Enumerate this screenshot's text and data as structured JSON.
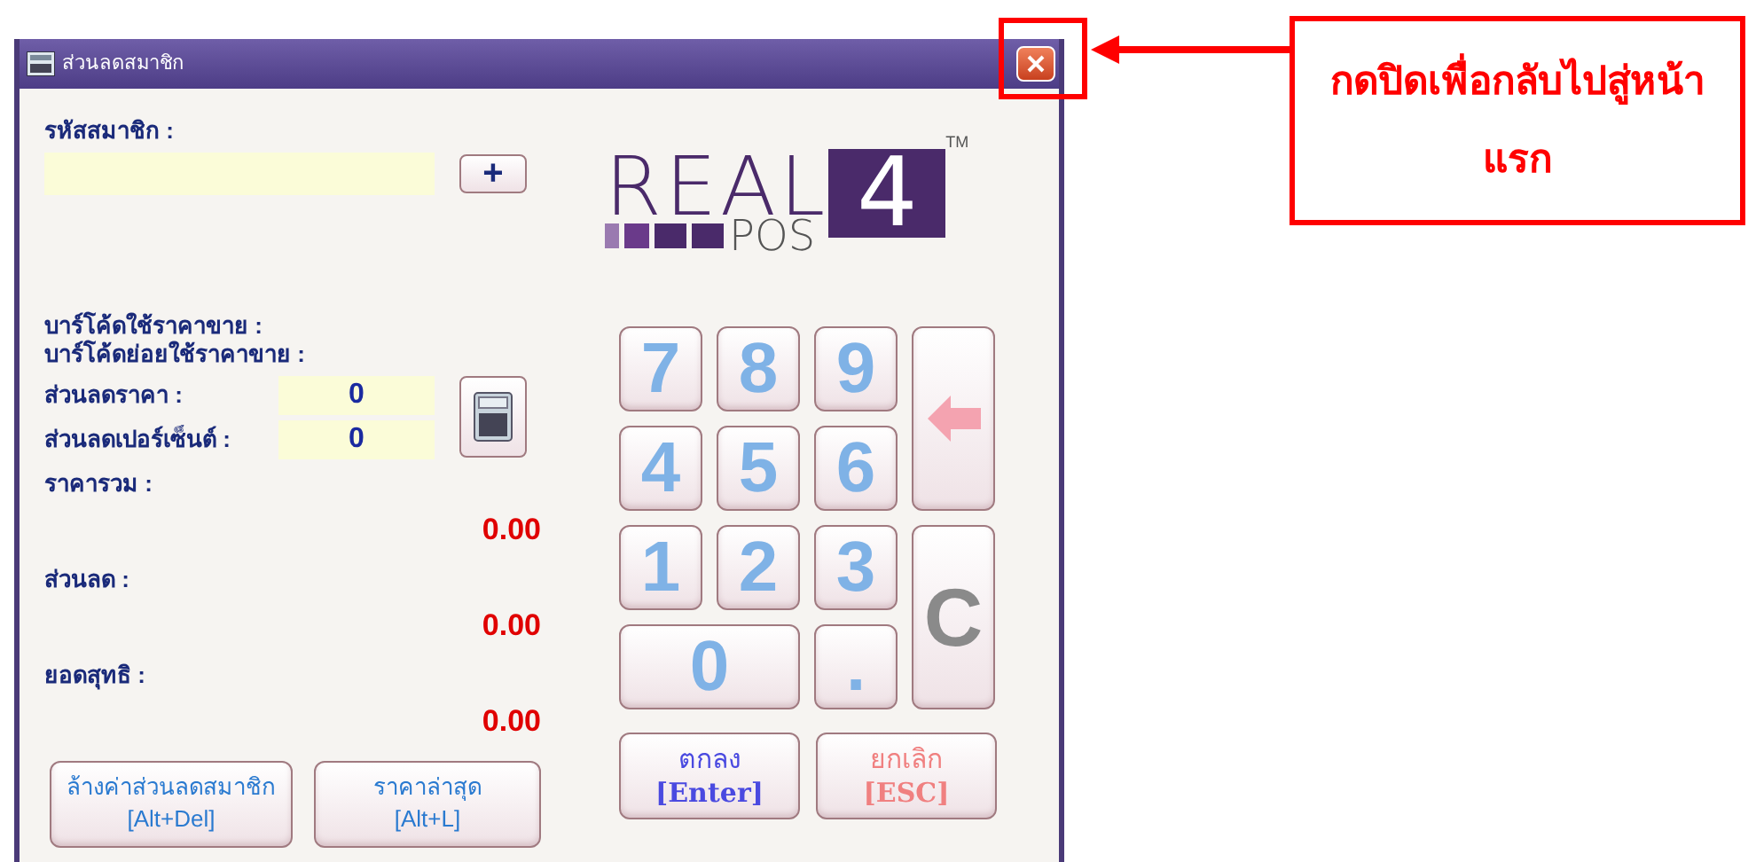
{
  "window": {
    "title": "ส่วนลดสมาชิก"
  },
  "member_code": {
    "label": "รหัสสมาชิก :",
    "add_button": "+"
  },
  "logo": {
    "word": "REAL",
    "sub": "POS",
    "number": "4",
    "mark": "TM"
  },
  "barcode_labels": [
    "บาร์โค้ดใช้ราคาขาย :",
    "บาร์โค้ดย่อยใช้ราคาขาย :"
  ],
  "discount_fields": [
    {
      "label": "ส่วนลดราคา :",
      "value": "0"
    },
    {
      "label": "ส่วนลดเปอร์เซ็นต์ :",
      "value": "0"
    }
  ],
  "totals": [
    {
      "label": "ราคารวม :",
      "value": "0.00"
    },
    {
      "label": "ส่วนลด :",
      "value": "0.00"
    },
    {
      "label": "ยอดสุทธิ :",
      "value": "0.00"
    }
  ],
  "keypad": [
    {
      "kind": "digit",
      "label": "7"
    },
    {
      "kind": "digit",
      "label": "8"
    },
    {
      "kind": "digit",
      "label": "9"
    },
    {
      "kind": "backspace"
    },
    {
      "kind": "digit",
      "label": "4"
    },
    {
      "kind": "digit",
      "label": "5"
    },
    {
      "kind": "digit",
      "label": "6"
    },
    {
      "kind": "digit",
      "label": "1"
    },
    {
      "kind": "digit",
      "label": "2"
    },
    {
      "kind": "digit",
      "label": "3"
    },
    {
      "kind": "clear",
      "label": "C"
    },
    {
      "kind": "zero",
      "label": "0"
    },
    {
      "kind": "digit",
      "label": "."
    }
  ],
  "left_buttons": [
    {
      "label": "ล้างค่าส่วนลดสมาชิก",
      "shortcut": "[Alt+Del]"
    },
    {
      "label": "ราคาล่าสุด",
      "shortcut": "[Alt+L]"
    }
  ],
  "right_buttons": [
    {
      "kind": "ok",
      "label": "ตกลง",
      "shortcut": "[Enter]"
    },
    {
      "kind": "cancel",
      "label": "ยกเลิก",
      "shortcut": "[ESC]"
    }
  ],
  "callout": {
    "text": "กดปิดเพื่อกลับไปสู่หน้าแรก"
  }
}
